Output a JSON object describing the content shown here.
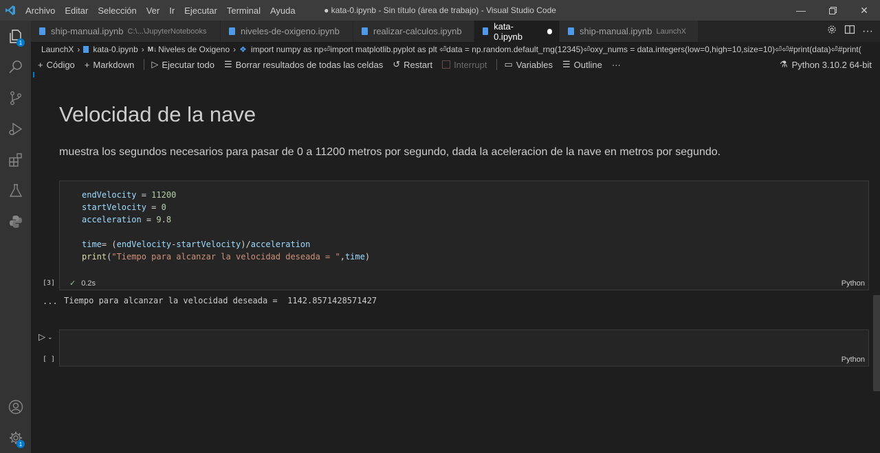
{
  "menu": [
    "Archivo",
    "Editar",
    "Selección",
    "Ver",
    "Ir",
    "Ejecutar",
    "Terminal",
    "Ayuda"
  ],
  "window_title": "● kata-0.ipynb - Sin título (área de trabajo) - Visual Studio Code",
  "colors": {
    "accent": "#007acc",
    "title_bar": "#3c3c3c",
    "editor_bg": "#1e1e1e"
  },
  "activity_badges": {
    "explorer": "1",
    "settings": "1"
  },
  "tabs": [
    {
      "label": "ship-manual.ipynb",
      "desc": "C:\\...\\JupyterNotebooks"
    },
    {
      "label": "niveles-de-oxigeno.ipynb",
      "desc": ""
    },
    {
      "label": "realizar-calculos.ipynb",
      "desc": ""
    },
    {
      "label": "kata-0.ipynb",
      "desc": ""
    },
    {
      "label": "ship-manual.ipynb",
      "desc": "LaunchX"
    }
  ],
  "breadcrumb": {
    "folder": "LaunchX",
    "file": "kata-0.ipynb",
    "md_badge": "M↓",
    "section": "Niveles de Oxigeno",
    "cell": "import numpy as np⏎import matplotlib.pyplot as plt ⏎data = np.random.default_rng(12345)⏎oxy_nums = data.integers(low=0,high=10,size=10)⏎⏎#print(data)⏎#print("
  },
  "toolbar": {
    "code": "Código",
    "markdown": "Markdown",
    "run_all": "Ejecutar todo",
    "clear": "Borrar resultados de todas las celdas",
    "restart": "Restart",
    "interrupt": "Interrupt",
    "variables": "Variables",
    "outline": "Outline",
    "more": "···",
    "kernel": "Python 3.10.2 64-bit"
  },
  "markdown": {
    "title": "Velocidad de la nave",
    "paragraph": "muestra los segundos necesarios para pasar de 0 a 11200 metros por segundo, dada la aceleracion de la nave en metros por segundo."
  },
  "code_cell": {
    "lines": {
      "l1_var": "endVelocity",
      "l1_op": " = ",
      "l1_val": "11200",
      "l2_var": "startVelocity",
      "l2_op": " = ",
      "l2_val": "0",
      "l3_var": "acceleration",
      "l3_op": " = ",
      "l3_val": "9.8",
      "l5_var": "time",
      "l5_a": "= (",
      "l5_b": "endVelocity",
      "l5_c": "-",
      "l5_d": "startVelocity",
      "l5_e": ")/",
      "l5_f": "acceleration",
      "l6_fn": "print",
      "l6_a": "(",
      "l6_str": "\"Tiempo para alcanzar la velocidad deseada = \"",
      "l6_b": ",",
      "l6_var": "time",
      "l6_c": ")"
    },
    "exec_count": "[3]",
    "duration": "0.2s",
    "language": "Python",
    "output_marker": "...",
    "output": "Tiempo para alcanzar la velocidad deseada =  1142.8571428571427"
  },
  "empty_cell": {
    "exec_count": "[ ]",
    "language": "Python"
  }
}
